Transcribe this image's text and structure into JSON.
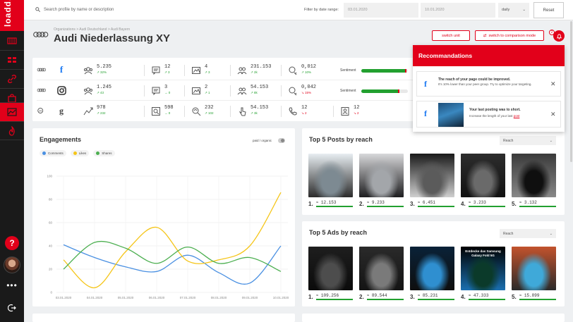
{
  "app": {
    "logo_text": "loadd."
  },
  "sidebar": {
    "items": [
      {
        "icon": "dashboard-icon"
      },
      {
        "icon": "grid-icon"
      },
      {
        "icon": "link-icon"
      },
      {
        "icon": "bag-icon"
      },
      {
        "icon": "chart-icon",
        "active": true
      },
      {
        "icon": "fire-icon"
      }
    ],
    "help": "?",
    "more": "•••"
  },
  "topbar": {
    "search_placeholder": "Search profile by name or description",
    "filter_label": "Filter by date range:",
    "date_from": "03.01.2020",
    "date_to": "10.01.2020",
    "granularity": "daily",
    "reset": "Reset"
  },
  "header": {
    "breadcrumb": "Organizations > Audi Deutschland > Audi Bayern",
    "title": "Audi Niederlassung XY",
    "switch_unit": "switch unit",
    "switch_comparison": "switch to comparison mode",
    "notification_count": "2"
  },
  "stats": {
    "rows": [
      {
        "network": "facebook",
        "network_glyph": "f",
        "metrics": [
          {
            "icon": "audience-icon",
            "value": "5.235",
            "delta": "↗ 32%",
            "dir": "up"
          },
          {
            "icon": "comment-icon",
            "value": "12",
            "delta": "↗ 3",
            "dir": "up"
          },
          {
            "icon": "image-icon",
            "value": "4",
            "delta": "↗ 3",
            "dir": "up"
          },
          {
            "icon": "people-icon",
            "value": "231.153",
            "delta": "↗ 2k",
            "dir": "up"
          },
          {
            "icon": "engagement-rate-icon",
            "value": "0,012",
            "delta": "↗ 10%",
            "dir": "up"
          }
        ],
        "sentiment_label": "Sentiment",
        "sentiment": 0.97
      },
      {
        "network": "instagram",
        "network_glyph": "◎",
        "metrics": [
          {
            "icon": "audience-icon",
            "value": "1.245",
            "delta": "↗ 43",
            "dir": "up"
          },
          {
            "icon": "comment-icon",
            "value": "3",
            "delta": "→ 0",
            "dir": "up"
          },
          {
            "icon": "image-icon",
            "value": "2",
            "delta": "↗ 1",
            "dir": "up"
          },
          {
            "icon": "people-icon",
            "value": "54.153",
            "delta": "↗ 8k",
            "dir": "up"
          },
          {
            "icon": "engagement-rate-icon",
            "value": "0,042",
            "delta": "↘ 15%",
            "dir": "down"
          }
        ],
        "sentiment_label": "Sentiment",
        "sentiment": 0.82
      },
      {
        "network": "google",
        "network_glyph": "g",
        "metrics": [
          {
            "icon": "trend-icon",
            "value": "978",
            "delta": "↗ 232",
            "dir": "up"
          },
          {
            "icon": "search-icon",
            "value": "598",
            "delta": "→ 0",
            "dir": "up"
          },
          {
            "icon": "map-search-icon",
            "value": "232",
            "delta": "↗ 102",
            "dir": "up"
          },
          {
            "icon": "click-icon",
            "value": "54.153",
            "delta": "↗ 3k",
            "dir": "up"
          },
          {
            "icon": "phone-icon",
            "value": "12",
            "delta": "↘ 2",
            "dir": "down"
          },
          {
            "icon": "contact-icon",
            "value": "12",
            "delta": "↘ 2",
            "dir": "down"
          }
        ]
      }
    ]
  },
  "engagements": {
    "title": "Engagements",
    "toggle_label": "paid / organic",
    "legend": [
      {
        "name": "Comments",
        "color": "#4a90e2"
      },
      {
        "name": "Likes",
        "color": "#f5c518"
      },
      {
        "name": "Shares",
        "color": "#4caf50"
      }
    ]
  },
  "chart_data": {
    "type": "line",
    "title": "Engagements",
    "x": [
      "03.01.2020",
      "04.01.2020",
      "05.01.2020",
      "06.01.2020",
      "07.01.2020",
      "08.01.2020",
      "09.01.2020",
      "10.01.2020"
    ],
    "ylim": [
      0,
      100
    ],
    "yticks": [
      "0",
      "20",
      "40",
      "60",
      "80",
      "100"
    ],
    "series": [
      {
        "name": "Comments",
        "color": "#4a90e2",
        "values": [
          41,
          30,
          22,
          18,
          32,
          17,
          8,
          40
        ]
      },
      {
        "name": "Likes",
        "color": "#f5c518",
        "values": [
          28,
          4,
          35,
          56,
          27,
          28,
          40,
          86
        ]
      },
      {
        "name": "Shares",
        "color": "#4caf50",
        "values": [
          20,
          43,
          38,
          25,
          39,
          25,
          30,
          18
        ]
      }
    ]
  },
  "top_posts": {
    "title": "Top 5 Posts by reach",
    "select": "Reach",
    "items": [
      {
        "rank": "1.",
        "value": "12.153",
        "colors": [
          "#e8eef2",
          "#7d8a92",
          "#2b2b2b"
        ]
      },
      {
        "rank": "2.",
        "value": "9.233",
        "colors": [
          "#d7d8da",
          "#a3a6aa",
          "#1d1d1f"
        ]
      },
      {
        "rank": "3.",
        "value": "6.451",
        "colors": [
          "#1a1a1a",
          "#5b5b5b",
          "#cfcfcf"
        ]
      },
      {
        "rank": "4.",
        "value": "3.233",
        "colors": [
          "#2d2d2d",
          "#6a6a6a",
          "#111111"
        ]
      },
      {
        "rank": "5.",
        "value": "3.132",
        "colors": [
          "#3a3a3a",
          "#0f0f0f",
          "#888888"
        ]
      }
    ]
  },
  "top_ads": {
    "title": "Top 5 Ads by reach",
    "select": "Reach",
    "items": [
      {
        "rank": "1.",
        "value": "109.256",
        "colors": [
          "#1e1e1e",
          "#4d4d4d",
          "#0b0b0b"
        ]
      },
      {
        "rank": "2.",
        "value": "89.544",
        "colors": [
          "#2a2a2a",
          "#7a7a7a",
          "#141414"
        ]
      },
      {
        "rank": "3.",
        "value": "85.231",
        "colors": [
          "#0a2238",
          "#2f8fd0",
          "#0e0e0e"
        ]
      },
      {
        "rank": "4.",
        "value": "47.333",
        "colors": [
          "#000000",
          "#0b3a2a",
          "#1a6fb0"
        ],
        "caption": "Entdecke das Samsung Galaxy Fold 5G"
      },
      {
        "rank": "5.",
        "value": "15.899",
        "colors": [
          "#c2532d",
          "#3fa9d9",
          "#2a2a2a"
        ]
      }
    ]
  },
  "recommendations": {
    "title": "Recommandations",
    "items": [
      {
        "title": "The reach of your page could be improved.",
        "text": "It's 10% lower than your peer group. Try to optimize your targeting."
      },
      {
        "title": "Your last posting was to short.",
        "text": "Increase the length of your last",
        "link": "post"
      }
    ]
  }
}
